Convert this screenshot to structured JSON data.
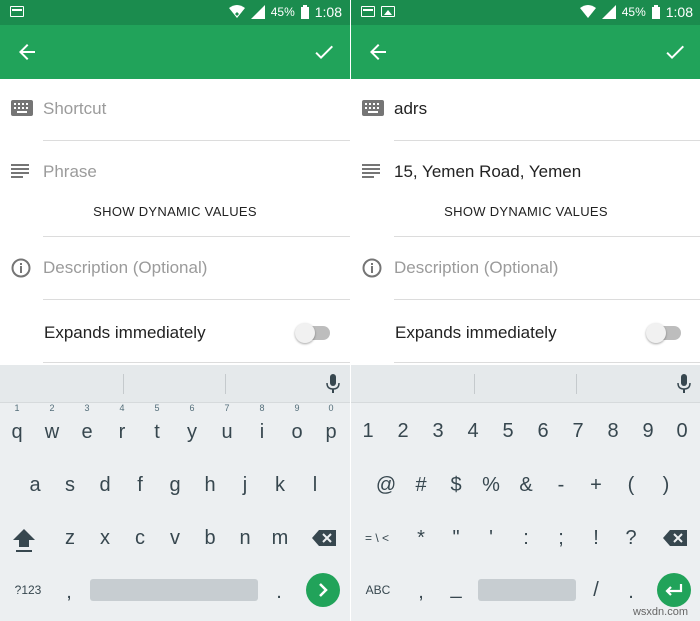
{
  "status_bar": {
    "battery": "45%",
    "time": "1:08"
  },
  "form_left": {
    "shortcut_placeholder": "Shortcut",
    "phrase_placeholder": "Phrase",
    "dynamic_values_label": "SHOW DYNAMIC VALUES",
    "description_placeholder": "Description (Optional)",
    "expands_label": "Expands immediately"
  },
  "form_right": {
    "shortcut_value": "adrs",
    "phrase_value": "15, Yemen Road, Yemen",
    "dynamic_values_label": "SHOW DYNAMIC VALUES",
    "description_placeholder": "Description (Optional)",
    "expands_label": "Expands immediately"
  },
  "keyboard_letters": {
    "row1": [
      "q",
      "w",
      "e",
      "r",
      "t",
      "y",
      "u",
      "i",
      "o",
      "p"
    ],
    "row1_hints": [
      "1",
      "2",
      "3",
      "4",
      "5",
      "6",
      "7",
      "8",
      "9",
      "0"
    ],
    "row2": [
      "a",
      "s",
      "d",
      "f",
      "g",
      "h",
      "j",
      "k",
      "l"
    ],
    "row3": [
      "z",
      "x",
      "c",
      "v",
      "b",
      "n",
      "m"
    ],
    "switch_label": "?123",
    "comma": ",",
    "period": "."
  },
  "keyboard_symbols": {
    "row1": [
      "1",
      "2",
      "3",
      "4",
      "5",
      "6",
      "7",
      "8",
      "9",
      "0"
    ],
    "row2": [
      "@",
      "#",
      "$",
      "%",
      "&",
      "-",
      "+",
      "(",
      ")"
    ],
    "row3": [
      "*",
      "\"",
      "'",
      ":",
      ";",
      "!",
      "?"
    ],
    "more_label": "= \\ <",
    "switch_label": "ABC",
    "comma": ",",
    "underscore": "_",
    "slash": "/",
    "period": "."
  },
  "watermark": "wsxdn.com",
  "colors": {
    "toolbar": "#21a35a",
    "status_bar": "#1b8c4e",
    "accent": "#21a35a"
  }
}
